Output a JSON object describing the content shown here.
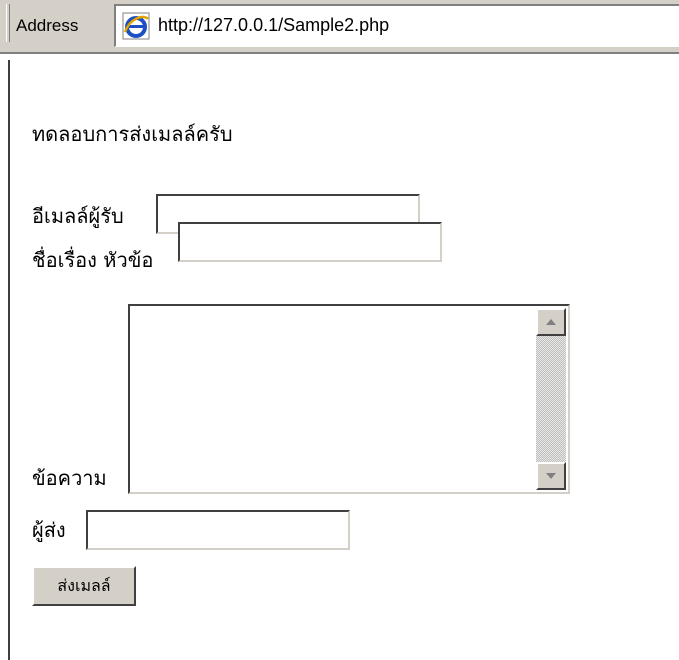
{
  "address_bar": {
    "label": "Address",
    "url": "http://127.0.0.1/Sample2.php"
  },
  "page": {
    "heading": "ทดลอบการส่งเมลล์ครับ",
    "form": {
      "recipient_label": "อีเมลล์ผู้รับ",
      "recipient_value": "",
      "subject_label": "ชื่อเรื่อง หัวข้อ",
      "subject_value": "",
      "message_label": "ข้อความ",
      "message_value": "",
      "sender_label": "ผู้ส่ง",
      "sender_value": "",
      "submit_label": "ส่งเมลล์"
    }
  },
  "icons": {
    "browser": "internet-explorer-icon",
    "scroll_up": "arrow-up-icon",
    "scroll_down": "arrow-down-icon"
  },
  "colors": {
    "chrome": "#d4d0c8",
    "background": "#ffffff"
  }
}
